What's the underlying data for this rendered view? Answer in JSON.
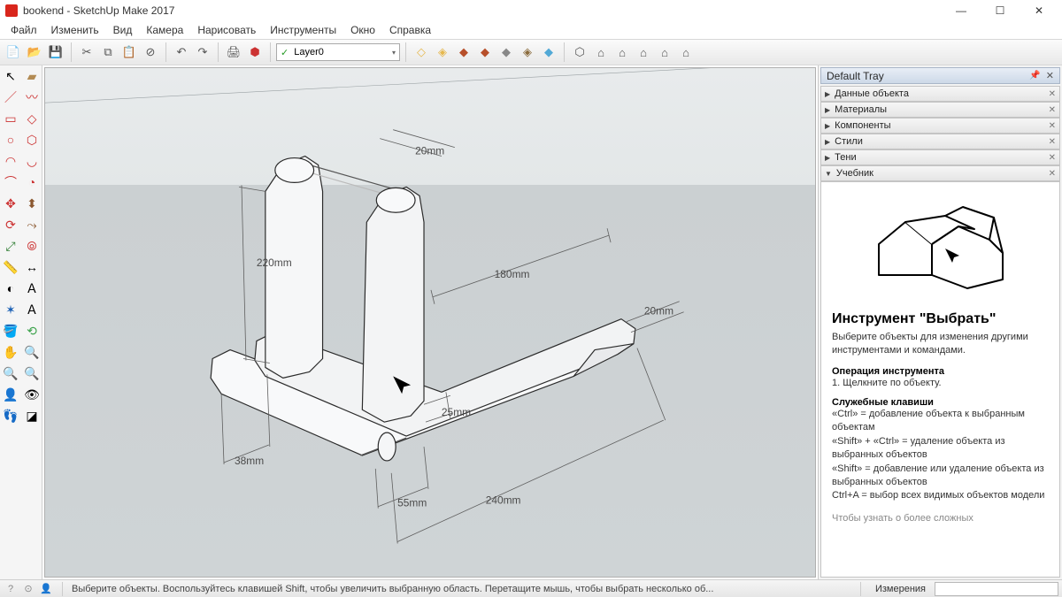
{
  "window": {
    "title": "bookend - SketchUp Make 2017",
    "min": "—",
    "max": "☐",
    "close": "✕"
  },
  "menu": [
    "Файл",
    "Изменить",
    "Вид",
    "Камера",
    "Нарисовать",
    "Инструменты",
    "Окно",
    "Справка"
  ],
  "layer": {
    "current": "Layer0"
  },
  "tray": {
    "title": "Default Tray",
    "panels": [
      "Данные объекта",
      "Материалы",
      "Компоненты",
      "Стили",
      "Тени",
      "Учебник"
    ]
  },
  "instructor": {
    "title": "Инструмент \"Выбрать\"",
    "lead": "Выберите объекты для изменения другими инструментами и командами.",
    "op_h": "Операция инструмента",
    "op_b": "1. Щелкните по объекту.",
    "mod_h": "Служебные клавиши",
    "mod_b": "«Ctrl» = добавление объекта к выбранным объектам\n«Shift» + «Ctrl» = удаление объекта из выбранных объектов\n«Shift» = добавление или удаление объекта из выбранных объектов\nCtrl+A = выбор всех видимых объектов модели",
    "more": "Чтобы узнать о более сложных"
  },
  "dimensions": {
    "d1": "20mm",
    "d2": "220mm",
    "d3": "180mm",
    "d4": "20mm",
    "d5": "25mm",
    "d6": "55mm",
    "d7": "38mm",
    "d8": "240mm"
  },
  "status": {
    "hint": "Выберите объекты. Воспользуйтесь клавишей Shift, чтобы увеличить выбранную область. Перетащите мышь, чтобы выбрать несколько об...",
    "measure_label": "Измерения"
  }
}
